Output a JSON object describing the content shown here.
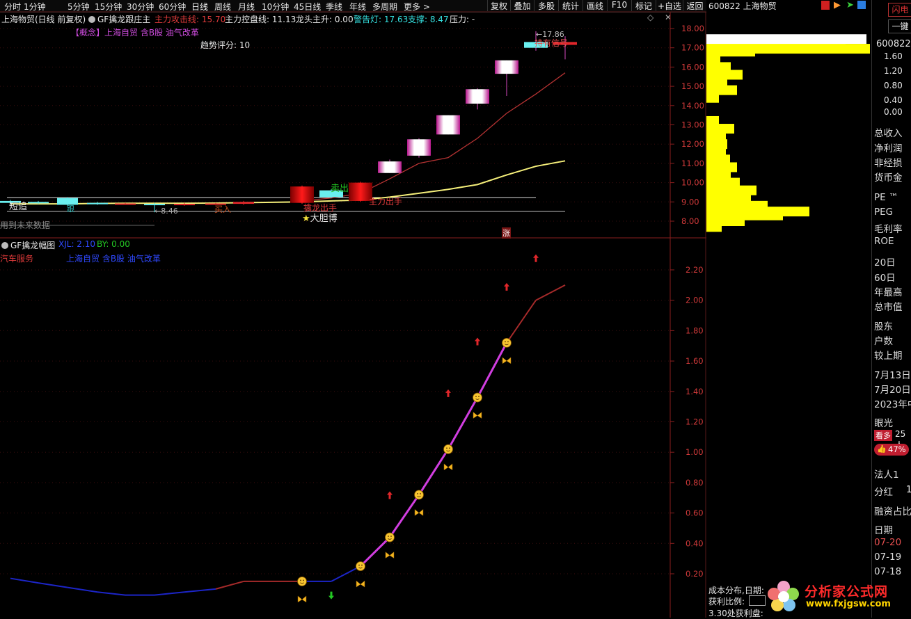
{
  "menu": {
    "timeframes": [
      "分时",
      "1分钟",
      "5分钟",
      "15分钟",
      "30分钟",
      "60分钟",
      "日线",
      "周线",
      "月线",
      "10分钟",
      "45日线",
      "季线",
      "年线",
      "多周期",
      "更多 >"
    ],
    "active_timeframe": "日线",
    "tools": [
      "复权",
      "叠加",
      "多股",
      "统计",
      "画线",
      "F10",
      "标记",
      "+自选",
      "返回"
    ]
  },
  "main_header": {
    "stock": "上海物贸(日线 前复权)",
    "indicator": "GF擒龙跟庄主",
    "attack_line": "主力攻击线: 15.70",
    "control_line": "主力控盘线: 11.13",
    "dragon": "龙头主升: 0.00",
    "warning": "警告灯: 17.63",
    "support": "支撑: 8.47",
    "pressure": "压力: -",
    "concept": "【概念】上海自贸 含B股 油气改革",
    "trend_score": "趋势评分:  10"
  },
  "main_chart_labels": {
    "short_chase": "短追",
    "follow": "跟",
    "sell_out": "卖出",
    "low_price": "8.46",
    "high_price": "17.86",
    "bold_bet": "大胆博",
    "future_data": "用到未来数据",
    "limit_up_mark": "涨",
    "main_shot": "主力出手",
    "dragon_shot": "擒龙出手",
    "buy_in": "买入",
    "hold": "持有信号"
  },
  "main_axis": [
    "18.00",
    "17.00",
    "16.00",
    "15.00",
    "14.00",
    "13.00",
    "12.00",
    "11.00",
    "10.00",
    "9.00",
    "8.00"
  ],
  "sub_header": {
    "indicator": "GF擒龙幅图",
    "xjl": "XJL: 2.10",
    "by": "BY: 0.00",
    "industry": "汽车服务",
    "concept": "上海自贸 含B股 油气改革"
  },
  "sub_axis": [
    "2.20",
    "2.00",
    "1.80",
    "1.60",
    "1.40",
    "1.20",
    "1.00",
    "0.80",
    "0.60",
    "0.40",
    "0.20"
  ],
  "chip_panel": {
    "title": "600822 上海物贸",
    "date_label": "成本分布,日期:",
    "profit_label": "获利比例:",
    "profit_at": "3.30处获利盘:"
  },
  "right_panel": {
    "flash_btn": "闪电",
    "one_key": "一键",
    "code": "600822",
    "scale": [
      "1.60",
      "1.20",
      "0.80",
      "0.40",
      "0.00"
    ],
    "fundamentals": [
      "总收入",
      "净利润",
      "非经损",
      "货币金",
      "PE ™",
      "PEG",
      "毛利率",
      "ROE"
    ],
    "stats": [
      "20日",
      "60日",
      "年最高",
      "总市值"
    ],
    "holders": [
      "股东",
      "户数",
      "较上期"
    ],
    "dates": [
      "7月13日",
      "7月20日",
      "2023年中"
    ],
    "vision": "眼光",
    "bullish": "看多",
    "bullish_count": "25人",
    "bullish_pct": "47%",
    "legal_person": "法人1",
    "dividend": "分红",
    "dividend_val": "1",
    "margin": "融资占比",
    "date_header": "日期",
    "date_rows": [
      "07-20",
      "07-19",
      "07-18"
    ]
  },
  "watermark": {
    "cn": "分析家公式网",
    "url": "www.fxjgsw.com"
  },
  "colors": {
    "background": "#000000",
    "up": "#e0262a",
    "down": "#3ee0e0",
    "axis": "#c83232",
    "ma_yellow": "#f5ef7a",
    "attack_line": "#b43232",
    "sub_magenta": "#d13ee0",
    "sub_blue": "#1c25c8",
    "sub_red": "#a52a2a",
    "chip_yellow": "#ffff00"
  },
  "chart_data": [
    {
      "type": "candlestick",
      "title": "上海物贸(日线 前复权)",
      "ylim": [
        7.6,
        18.2
      ],
      "candles": [
        {
          "open": 9.05,
          "close": 8.95,
          "high": 9.1,
          "low": 8.9
        },
        {
          "open": 9.0,
          "close": 8.95,
          "high": 9.05,
          "low": 8.9
        },
        {
          "open": 9.2,
          "close": 8.85,
          "high": 9.25,
          "low": 8.8
        },
        {
          "open": 8.95,
          "close": 8.9,
          "high": 9.0,
          "low": 8.85
        },
        {
          "open": 8.9,
          "close": 8.92,
          "high": 8.95,
          "low": 8.85
        },
        {
          "open": 8.9,
          "close": 8.85,
          "high": 8.95,
          "low": 8.46
        },
        {
          "open": 8.85,
          "close": 8.9,
          "high": 8.95,
          "low": 8.8
        },
        {
          "open": 8.9,
          "close": 8.92,
          "high": 8.95,
          "low": 8.85
        },
        {
          "open": 8.9,
          "close": 9.0,
          "high": 9.05,
          "low": 8.85
        },
        {
          "open": 8.95,
          "close": 9.8,
          "high": 9.85,
          "low": 8.9
        },
        {
          "open": 9.6,
          "close": 9.25,
          "high": 9.65,
          "low": 9.2
        },
        {
          "open": 9.05,
          "close": 10.0,
          "high": 10.05,
          "low": 9.0
        },
        {
          "open": 10.5,
          "close": 11.1,
          "high": 11.2,
          "low": 10.5
        },
        {
          "open": 11.4,
          "close": 12.25,
          "high": 12.3,
          "low": 11.3
        },
        {
          "open": 12.5,
          "close": 13.5,
          "high": 13.5,
          "low": 12.5
        },
        {
          "open": 14.1,
          "close": 14.85,
          "high": 14.9,
          "low": 13.8
        },
        {
          "open": 15.65,
          "close": 16.35,
          "high": 16.35,
          "low": 14.5
        },
        {
          "open": 17.3,
          "close": 17.0,
          "high": 17.86,
          "low": 16.85
        },
        {
          "open": 17.15,
          "close": 17.3,
          "high": 17.6,
          "low": 16.4
        }
      ]
    },
    {
      "type": "line",
      "title": "GF擒龙幅图",
      "ylim": [
        0.1,
        2.35
      ],
      "series": [
        {
          "name": "XJL",
          "values": [
            0.17,
            0.14,
            0.11,
            0.08,
            0.06,
            0.06,
            0.08,
            0.1,
            0.15,
            0.15,
            0.15,
            0.25,
            0.44,
            0.72,
            1.02,
            1.36,
            1.72,
            2.0,
            2.1
          ]
        }
      ]
    }
  ]
}
